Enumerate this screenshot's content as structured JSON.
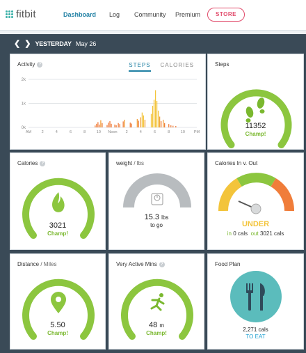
{
  "nav": {
    "logo": "fitbit",
    "items": [
      "Dashboard",
      "Log",
      "Community",
      "Premium"
    ],
    "store": "STORE"
  },
  "date": {
    "day": "YESTERDAY",
    "date": "May 26"
  },
  "activity": {
    "title": "Activity",
    "tabs": [
      "STEPS",
      "CALORIES"
    ],
    "y_ticks": [
      "2k",
      "1k",
      "0k"
    ],
    "x_ticks": [
      "AM",
      "2",
      "4",
      "6",
      "8",
      "10",
      "Noon",
      "2",
      "4",
      "6",
      "8",
      "10",
      "PM"
    ]
  },
  "chart_data": {
    "type": "bar",
    "ylim": [
      0,
      2000
    ],
    "x": [
      9.5,
      9.7,
      9.9,
      10.1,
      10.3,
      10.5,
      11.2,
      11.4,
      11.6,
      11.8,
      12.3,
      12.5,
      12.8,
      13,
      13.5,
      13.7,
      14.5,
      14.7,
      15.5,
      15.7,
      16,
      16.2,
      16.4,
      16.6,
      17.5,
      17.7,
      17.9,
      18.1,
      18.3,
      18.5,
      18.7,
      18.9,
      19.2,
      19.4,
      20,
      20.3,
      20.6,
      21
    ],
    "values": [
      80,
      150,
      220,
      120,
      300,
      180,
      100,
      200,
      260,
      150,
      120,
      90,
      180,
      140,
      250,
      320,
      200,
      160,
      350,
      280,
      420,
      620,
      500,
      320,
      560,
      900,
      1150,
      1550,
      1100,
      700,
      450,
      260,
      320,
      180,
      140,
      90,
      70,
      60
    ]
  },
  "steps": {
    "title": "Steps",
    "value": "11352",
    "status": "Champ!",
    "level": 1.0
  },
  "calories": {
    "title": "Calories",
    "value": "3021",
    "status": "Champ!",
    "level": 1.0
  },
  "weight": {
    "title": "weight",
    "unit": "/ lbs",
    "value": "15.3",
    "value_unit": "lbs",
    "sub": "to go",
    "level": 1.0
  },
  "calories_inout": {
    "title": "Calories In v. Out",
    "status": "UNDER",
    "in_label": "in",
    "in_value": "0 cals",
    "out_label": "out",
    "out_value": "3021 cals"
  },
  "distance": {
    "title": "Distance",
    "unit": "/ Miles",
    "value": "5.50",
    "status": "Champ!",
    "level": 1.0
  },
  "active": {
    "title": "Very Active Mins",
    "value": "48",
    "value_unit": "m",
    "status": "Champ!",
    "level": 1.0
  },
  "food": {
    "title": "Food Plan",
    "value": "2,271 cals",
    "sub": "TO EAT"
  },
  "colors": {
    "green": "#8cc63f",
    "teal": "#5bbcbc",
    "orange": "#f07d3a",
    "yellow": "#f3c43b",
    "gray": "#b8bcbf"
  }
}
